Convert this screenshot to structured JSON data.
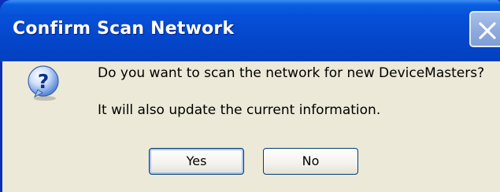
{
  "window": {
    "title": "Confirm Scan Network"
  },
  "dialog": {
    "icon": "question-icon",
    "message_line1": "Do you want to scan the network for new DeviceMasters?",
    "message_line2": "It will also update the current information."
  },
  "buttons": {
    "yes_label": "Yes",
    "no_label": "No"
  },
  "colors": {
    "titlebar": "#0650d8",
    "client_bg": "#ece9d8",
    "button_border": "#003c74"
  }
}
